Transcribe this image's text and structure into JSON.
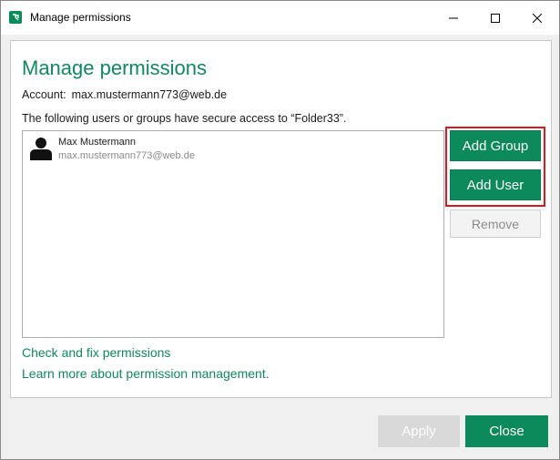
{
  "window": {
    "title": "Manage permissions",
    "app_icon": "app-logo-icon",
    "controls": [
      "minimize-icon",
      "maximize-icon",
      "close-icon"
    ]
  },
  "dialog": {
    "heading": "Manage permissions",
    "account_label": "Account:",
    "account_value": "max.mustermann773@web.de",
    "access_text": "The following users or groups have secure access to “Folder33”.",
    "users": [
      {
        "name": "Max Mustermann",
        "email": "max.mustermann773@web.de",
        "icon": "user-avatar-icon"
      }
    ],
    "buttons": {
      "add_group": "Add Group",
      "add_user": "Add User",
      "remove": "Remove"
    },
    "links": {
      "check_fix": "Check and fix permissions",
      "learn_more": "Learn more about permission management."
    }
  },
  "footer": {
    "apply": "Apply",
    "close": "Close"
  },
  "colors": {
    "accent": "#0d8a5b",
    "highlight": "#e0181b",
    "disabled": "#d9d9d9"
  }
}
